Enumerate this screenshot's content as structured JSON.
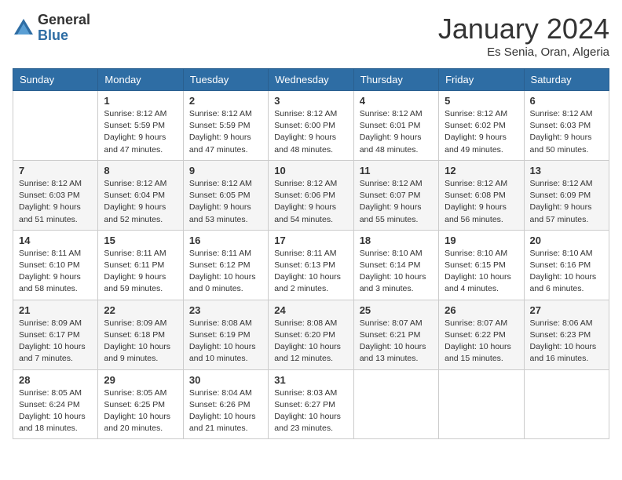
{
  "header": {
    "logo_general": "General",
    "logo_blue": "Blue",
    "month_title": "January 2024",
    "location": "Es Senia, Oran, Algeria"
  },
  "weekdays": [
    "Sunday",
    "Monday",
    "Tuesday",
    "Wednesday",
    "Thursday",
    "Friday",
    "Saturday"
  ],
  "weeks": [
    [
      {
        "day": "",
        "info": ""
      },
      {
        "day": "1",
        "info": "Sunrise: 8:12 AM\nSunset: 5:59 PM\nDaylight: 9 hours\nand 47 minutes."
      },
      {
        "day": "2",
        "info": "Sunrise: 8:12 AM\nSunset: 5:59 PM\nDaylight: 9 hours\nand 47 minutes."
      },
      {
        "day": "3",
        "info": "Sunrise: 8:12 AM\nSunset: 6:00 PM\nDaylight: 9 hours\nand 48 minutes."
      },
      {
        "day": "4",
        "info": "Sunrise: 8:12 AM\nSunset: 6:01 PM\nDaylight: 9 hours\nand 48 minutes."
      },
      {
        "day": "5",
        "info": "Sunrise: 8:12 AM\nSunset: 6:02 PM\nDaylight: 9 hours\nand 49 minutes."
      },
      {
        "day": "6",
        "info": "Sunrise: 8:12 AM\nSunset: 6:03 PM\nDaylight: 9 hours\nand 50 minutes."
      }
    ],
    [
      {
        "day": "7",
        "info": "Sunrise: 8:12 AM\nSunset: 6:03 PM\nDaylight: 9 hours\nand 51 minutes."
      },
      {
        "day": "8",
        "info": "Sunrise: 8:12 AM\nSunset: 6:04 PM\nDaylight: 9 hours\nand 52 minutes."
      },
      {
        "day": "9",
        "info": "Sunrise: 8:12 AM\nSunset: 6:05 PM\nDaylight: 9 hours\nand 53 minutes."
      },
      {
        "day": "10",
        "info": "Sunrise: 8:12 AM\nSunset: 6:06 PM\nDaylight: 9 hours\nand 54 minutes."
      },
      {
        "day": "11",
        "info": "Sunrise: 8:12 AM\nSunset: 6:07 PM\nDaylight: 9 hours\nand 55 minutes."
      },
      {
        "day": "12",
        "info": "Sunrise: 8:12 AM\nSunset: 6:08 PM\nDaylight: 9 hours\nand 56 minutes."
      },
      {
        "day": "13",
        "info": "Sunrise: 8:12 AM\nSunset: 6:09 PM\nDaylight: 9 hours\nand 57 minutes."
      }
    ],
    [
      {
        "day": "14",
        "info": "Sunrise: 8:11 AM\nSunset: 6:10 PM\nDaylight: 9 hours\nand 58 minutes."
      },
      {
        "day": "15",
        "info": "Sunrise: 8:11 AM\nSunset: 6:11 PM\nDaylight: 9 hours\nand 59 minutes."
      },
      {
        "day": "16",
        "info": "Sunrise: 8:11 AM\nSunset: 6:12 PM\nDaylight: 10 hours\nand 0 minutes."
      },
      {
        "day": "17",
        "info": "Sunrise: 8:11 AM\nSunset: 6:13 PM\nDaylight: 10 hours\nand 2 minutes."
      },
      {
        "day": "18",
        "info": "Sunrise: 8:10 AM\nSunset: 6:14 PM\nDaylight: 10 hours\nand 3 minutes."
      },
      {
        "day": "19",
        "info": "Sunrise: 8:10 AM\nSunset: 6:15 PM\nDaylight: 10 hours\nand 4 minutes."
      },
      {
        "day": "20",
        "info": "Sunrise: 8:10 AM\nSunset: 6:16 PM\nDaylight: 10 hours\nand 6 minutes."
      }
    ],
    [
      {
        "day": "21",
        "info": "Sunrise: 8:09 AM\nSunset: 6:17 PM\nDaylight: 10 hours\nand 7 minutes."
      },
      {
        "day": "22",
        "info": "Sunrise: 8:09 AM\nSunset: 6:18 PM\nDaylight: 10 hours\nand 9 minutes."
      },
      {
        "day": "23",
        "info": "Sunrise: 8:08 AM\nSunset: 6:19 PM\nDaylight: 10 hours\nand 10 minutes."
      },
      {
        "day": "24",
        "info": "Sunrise: 8:08 AM\nSunset: 6:20 PM\nDaylight: 10 hours\nand 12 minutes."
      },
      {
        "day": "25",
        "info": "Sunrise: 8:07 AM\nSunset: 6:21 PM\nDaylight: 10 hours\nand 13 minutes."
      },
      {
        "day": "26",
        "info": "Sunrise: 8:07 AM\nSunset: 6:22 PM\nDaylight: 10 hours\nand 15 minutes."
      },
      {
        "day": "27",
        "info": "Sunrise: 8:06 AM\nSunset: 6:23 PM\nDaylight: 10 hours\nand 16 minutes."
      }
    ],
    [
      {
        "day": "28",
        "info": "Sunrise: 8:05 AM\nSunset: 6:24 PM\nDaylight: 10 hours\nand 18 minutes."
      },
      {
        "day": "29",
        "info": "Sunrise: 8:05 AM\nSunset: 6:25 PM\nDaylight: 10 hours\nand 20 minutes."
      },
      {
        "day": "30",
        "info": "Sunrise: 8:04 AM\nSunset: 6:26 PM\nDaylight: 10 hours\nand 21 minutes."
      },
      {
        "day": "31",
        "info": "Sunrise: 8:03 AM\nSunset: 6:27 PM\nDaylight: 10 hours\nand 23 minutes."
      },
      {
        "day": "",
        "info": ""
      },
      {
        "day": "",
        "info": ""
      },
      {
        "day": "",
        "info": ""
      }
    ]
  ]
}
